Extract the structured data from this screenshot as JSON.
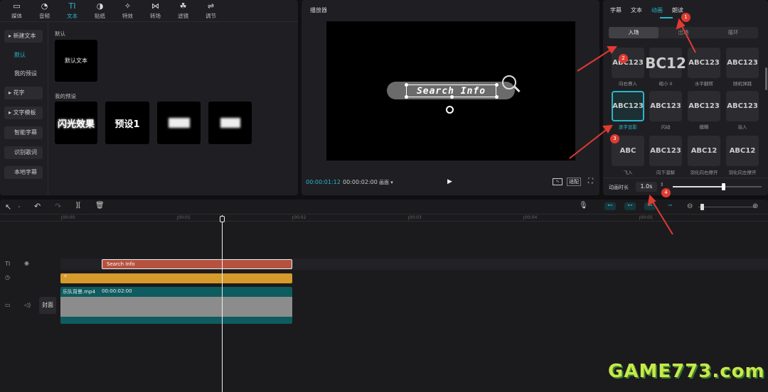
{
  "toolbar": {
    "items": [
      {
        "label": "媒体",
        "icon": "▭"
      },
      {
        "label": "音频",
        "icon": "◔"
      },
      {
        "label": "文本",
        "icon": "TI"
      },
      {
        "label": "贴纸",
        "icon": "◑"
      },
      {
        "label": "特效",
        "icon": "✧"
      },
      {
        "label": "转场",
        "icon": "⋈"
      },
      {
        "label": "滤镜",
        "icon": "☘"
      },
      {
        "label": "调节",
        "icon": "⇌"
      }
    ]
  },
  "left_nav": {
    "new_text": "新建文本",
    "default": "默认",
    "my_presets": "我的预设",
    "flower": "花字",
    "template": "文字模板",
    "smart_caption": "智能字幕",
    "lyrics": "识别歌词",
    "local_caption": "本地字幕"
  },
  "library": {
    "section_default": "默认",
    "default_tile": "默认文本",
    "section_presets": "我的预设",
    "tile_flash": "闪光效果",
    "tile_preset1": "预设1"
  },
  "player": {
    "title": "播放器",
    "canvas_text": "Search Info",
    "current_time": "00:00:01:12",
    "total_time": "00:00:02:00",
    "ratio": "画面",
    "original": "适配"
  },
  "right": {
    "tabs": [
      "字幕",
      "文本",
      "动画",
      "朗读"
    ],
    "seg": [
      "入场",
      "出场",
      "循环"
    ],
    "grid": [
      {
        "thumb": "ABC123",
        "label": "向右擦入"
      },
      {
        "thumb": "BC12",
        "label": "缩小 II"
      },
      {
        "thumb": "ABC123",
        "label": "水平翻转"
      },
      {
        "thumb": "ABC123",
        "label": "随机弹跳"
      },
      {
        "thumb": "ABC123",
        "label": "逐字显影"
      },
      {
        "thumb": "ABC123",
        "label": "闪动"
      },
      {
        "thumb": "ABC123",
        "label": "模糊"
      },
      {
        "thumb": "ABC123",
        "label": "溢入"
      },
      {
        "thumb": "ABC",
        "label": "飞入"
      },
      {
        "thumb": "ABC123",
        "label": "向下溜解"
      },
      {
        "thumb": "ABC12",
        "label": "羽化向右擦开"
      },
      {
        "thumb": "ABC12",
        "label": "羽化向左擦开"
      }
    ],
    "duration_label": "动画时长",
    "duration_value": "1.0s",
    "duration_fraction": 0.55
  },
  "markers": [
    "1",
    "2",
    "3",
    "4"
  ],
  "timeline": {
    "ruler": [
      "00:00",
      "00:01",
      "00:02",
      "00:03",
      "00:04",
      "00:05"
    ],
    "text_clip": "Search Info",
    "video_clip_name": "乐队背景.mp4",
    "video_clip_dur": "00:00:02:00",
    "cover": "封面"
  },
  "watermark": {
    "text": "GAME773.com"
  },
  "colors": {
    "accent": "#2ab6c9",
    "text_clip": "#b5523f",
    "effect_clip": "#d69a2c",
    "video_clip": "#0e5c5f",
    "marker": "#e03a32"
  }
}
